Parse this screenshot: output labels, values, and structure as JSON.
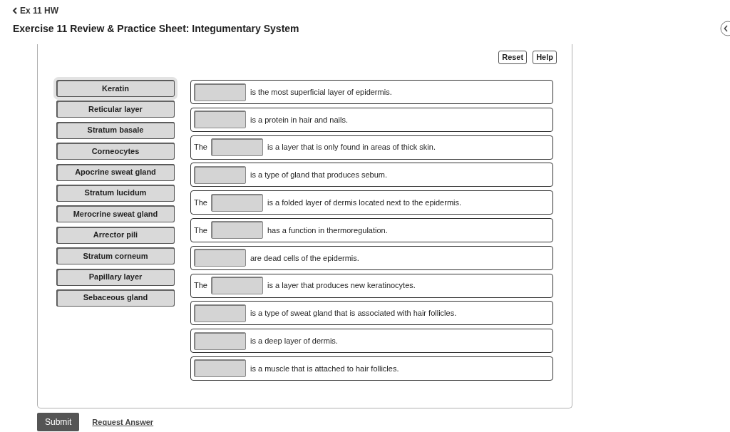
{
  "breadcrumb": {
    "label": "Ex 11 HW"
  },
  "title": "Exercise 11 Review & Practice Sheet: Integumentary System",
  "toolbar_buttons": [
    "Reset",
    "Help"
  ],
  "answer_tiles": [
    {
      "label": "Keratin",
      "selected": true
    },
    {
      "label": "Reticular layer",
      "selected": false
    },
    {
      "label": "Stratum basale",
      "selected": false
    },
    {
      "label": "Corneocytes",
      "selected": false
    },
    {
      "label": "Apocrine sweat gland",
      "selected": false
    },
    {
      "label": "Stratum lucidum",
      "selected": false
    },
    {
      "label": "Merocrine sweat gland",
      "selected": false
    },
    {
      "label": "Arrector pili",
      "selected": false
    },
    {
      "label": "Stratum corneum",
      "selected": false
    },
    {
      "label": "Papillary layer",
      "selected": false
    },
    {
      "label": "Sebaceous gland",
      "selected": false
    }
  ],
  "statements": [
    {
      "text": "is the most superficial layer of epidermis."
    },
    {
      "text": "is a protein in hair and nails."
    },
    {
      "prefix": "The",
      "text": "is a layer that is only found in areas of thick skin."
    },
    {
      "text": "is a type of gland that produces sebum."
    },
    {
      "prefix": "The",
      "text": "is a folded layer of dermis located next to the epidermis."
    },
    {
      "prefix": "The",
      "text": "has a function in thermoregulation."
    },
    {
      "text": "are dead cells of the epidermis."
    },
    {
      "prefix": "The",
      "text": "is a layer that produces new keratinocytes."
    },
    {
      "text": "is a type of sweat gland that is associated with hair follicles."
    },
    {
      "text": "is a deep layer of dermis."
    },
    {
      "text": "is a muscle that is attached to hair follicles."
    }
  ],
  "actions": {
    "submit": "Submit",
    "request_answer": "Request Answer"
  }
}
